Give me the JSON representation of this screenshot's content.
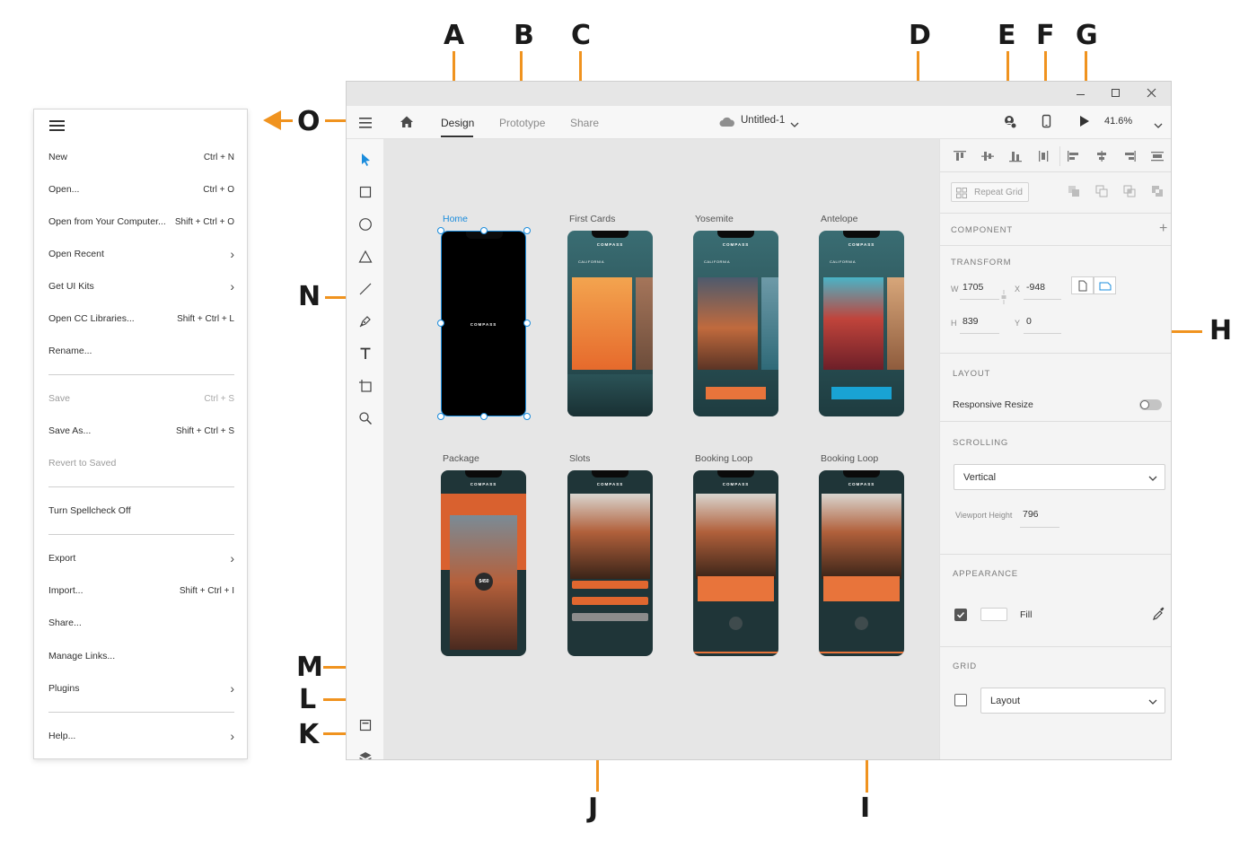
{
  "callouts": {
    "a": "A",
    "b": "B",
    "c": "C",
    "d": "D",
    "e": "E",
    "f": "F",
    "g": "G",
    "h": "H",
    "i": "I",
    "j": "J",
    "k": "K",
    "l": "L",
    "m": "M",
    "n": "N",
    "o": "O"
  },
  "menu": {
    "items": [
      {
        "label": "New",
        "shortcut": "Ctrl + N"
      },
      {
        "label": "Open...",
        "shortcut": "Ctrl + O"
      },
      {
        "label": "Open from Your Computer...",
        "shortcut": "Shift + Ctrl + O"
      },
      {
        "label": "Open Recent",
        "shortcut": ""
      },
      {
        "label": "Get UI Kits",
        "shortcut": ""
      },
      {
        "label": "Open CC Libraries...",
        "shortcut": "Shift + Ctrl + L"
      },
      {
        "label": "Rename...",
        "shortcut": ""
      },
      {
        "label": "Save",
        "shortcut": "Ctrl + S"
      },
      {
        "label": "Save As...",
        "shortcut": "Shift + Ctrl + S"
      },
      {
        "label": "Revert to Saved",
        "shortcut": ""
      },
      {
        "label": "Turn Spellcheck Off",
        "shortcut": ""
      },
      {
        "label": "Export",
        "shortcut": ""
      },
      {
        "label": "Import...",
        "shortcut": "Shift + Ctrl + I"
      },
      {
        "label": "Share...",
        "shortcut": ""
      },
      {
        "label": "Manage Links...",
        "shortcut": ""
      },
      {
        "label": "Plugins",
        "shortcut": ""
      },
      {
        "label": "Help...",
        "shortcut": ""
      }
    ]
  },
  "toolbar": {
    "tabs": [
      "Design",
      "Prototype",
      "Share"
    ],
    "doc_title": "Untitled-1",
    "zoom": "41.6%"
  },
  "artboards": {
    "labels": [
      "Home",
      "First Cards",
      "Yosemite",
      "Antelope",
      "Package",
      "Slots",
      "Booking Loop",
      "Booking Loop"
    ],
    "brand": "COMPASS",
    "california": "CALIFORNIA",
    "price": "$450"
  },
  "properties": {
    "repeat_grid": "Repeat Grid",
    "component": "COMPONENT",
    "transform": "TRANSFORM",
    "w_label": "W",
    "w_value": "1705",
    "x_label": "X",
    "x_value": "-948",
    "h_label": "H",
    "h_value": "839",
    "y_label": "Y",
    "y_value": "0",
    "layout": "LAYOUT",
    "responsive_resize": "Responsive Resize",
    "scrolling": "SCROLLING",
    "scrolling_value": "Vertical",
    "viewport_height_label": "Viewport Height",
    "viewport_height_value": "796",
    "appearance": "APPEARANCE",
    "fill_label": "Fill",
    "grid": "GRID",
    "grid_value": "Layout"
  },
  "colors": {
    "accent": "#f0931f",
    "selection": "#1a8cdc",
    "phone_dark": "#20393d",
    "orange_card": "#e8743b"
  }
}
